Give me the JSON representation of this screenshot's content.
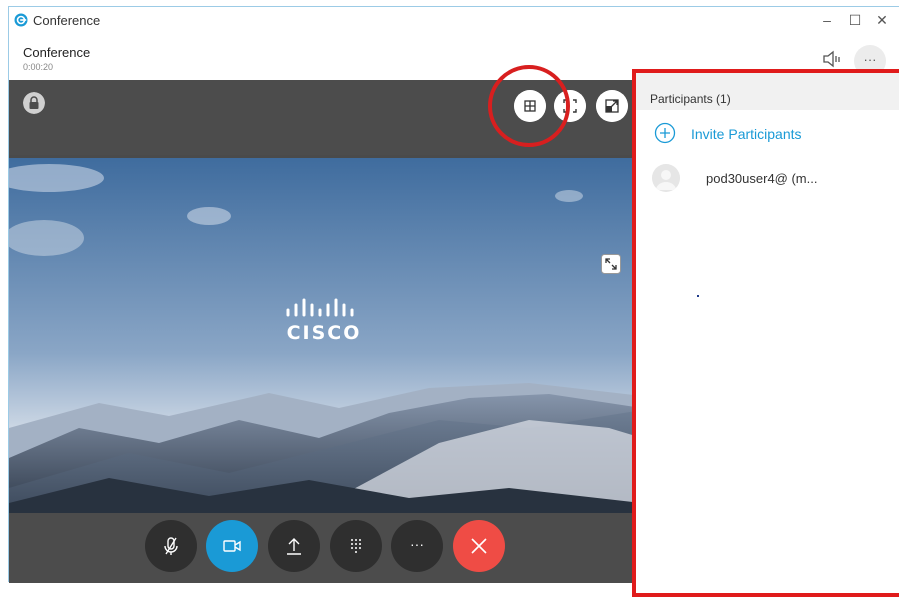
{
  "window": {
    "app_title": "Conference",
    "minimize_glyph": "–",
    "maximize_glyph": "☐",
    "close_glyph": "✕"
  },
  "header": {
    "title": "Conference",
    "timer": "0:00:20",
    "more_glyph": "···"
  },
  "video": {
    "brand_text": "CISCO"
  },
  "controls": {
    "more_glyph": "···"
  },
  "participants_panel": {
    "title": "Participants (1)",
    "invite_label": "Invite Participants",
    "participants": [
      {
        "name": "pod30user4@ (m..."
      }
    ]
  },
  "colors": {
    "accent": "#1a9ad6",
    "end_call": "#ef4c45",
    "annotation": "#e01b1b"
  },
  "icons": [
    "app-icon",
    "speaker-icon",
    "lock-icon",
    "grid-layout-icon",
    "fullscreen-icon",
    "popout-icon",
    "expand-icon",
    "mute-mic-icon",
    "video-camera-icon",
    "share-upload-icon",
    "dialpad-icon",
    "more-icon",
    "end-call-icon",
    "invite-plus-icon",
    "avatar-icon"
  ]
}
